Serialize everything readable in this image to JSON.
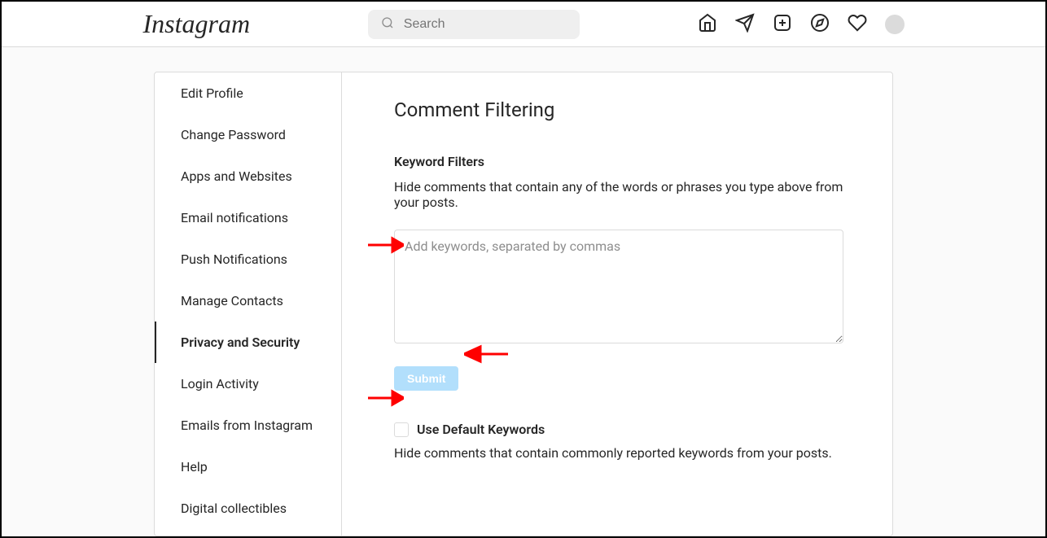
{
  "header": {
    "logo": "Instagram",
    "search_placeholder": "Search"
  },
  "sidebar": {
    "items": [
      {
        "label": "Edit Profile"
      },
      {
        "label": "Change Password"
      },
      {
        "label": "Apps and Websites"
      },
      {
        "label": "Email notifications"
      },
      {
        "label": "Push Notifications"
      },
      {
        "label": "Manage Contacts"
      },
      {
        "label": "Privacy and Security"
      },
      {
        "label": "Login Activity"
      },
      {
        "label": "Emails from Instagram"
      },
      {
        "label": "Help"
      },
      {
        "label": "Digital collectibles"
      }
    ],
    "active_index": 6
  },
  "main": {
    "title": "Comment Filtering",
    "keyword_filters": {
      "label": "Keyword Filters",
      "description": "Hide comments that contain any of the words or phrases you type above from your posts.",
      "textarea_placeholder": "Add keywords, separated by commas",
      "submit_label": "Submit"
    },
    "default_keywords": {
      "checkbox_label": "Use Default Keywords",
      "description": "Hide comments that contain commonly reported keywords from your posts."
    }
  }
}
